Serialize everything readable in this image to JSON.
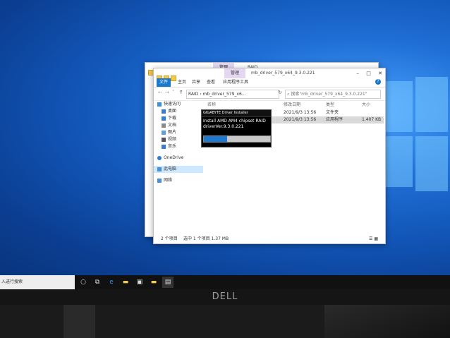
{
  "explorer_back": {
    "title": "RAID",
    "manage_tab": "管理"
  },
  "explorer": {
    "manage_tab": "管理",
    "title": "mb_driver_579_x64_9.3.0.221",
    "ribbon_tabs": [
      "文件",
      "主页",
      "共享",
      "查看",
      "应用程序工具"
    ],
    "address_path": "RAID › mb_driver_579_x6...",
    "search_placeholder": "搜索\"mb_driver_579_x64_9.3.0.221\"",
    "nav": {
      "quick_access": "快速访问",
      "desktop": "桌面",
      "downloads": "下载",
      "documents": "文档",
      "pictures": "图片",
      "videos": "视频",
      "music": "音乐",
      "onedrive": "OneDrive",
      "this_pc": "此电脑",
      "network": "网络"
    },
    "columns": {
      "name": "名称",
      "date": "修改日期",
      "type": "类型",
      "size": "大小"
    },
    "rows": [
      {
        "date": "2021/9/3 13:56",
        "type": "文件夹",
        "size": ""
      },
      {
        "date": "2021/9/3 13:56",
        "type": "应用程序",
        "size": "1,407 KB"
      }
    ],
    "status": {
      "count": "2 个项目",
      "selected": "选中 1 个项目  1.37 MB"
    }
  },
  "dialog": {
    "title": "GIGABYTE Driver Installer",
    "line1": "Install AMD AM4 chipset RAID",
    "line2": "driverVer.9.3.0.221",
    "progress": 0.35
  },
  "taskbar": {
    "search_text": "入进行搜索"
  },
  "monitor": {
    "brand": "DELL"
  },
  "colors": {
    "accent": "#1979ca",
    "progress": "#1e7ad1",
    "desktop": "#1256b8"
  }
}
